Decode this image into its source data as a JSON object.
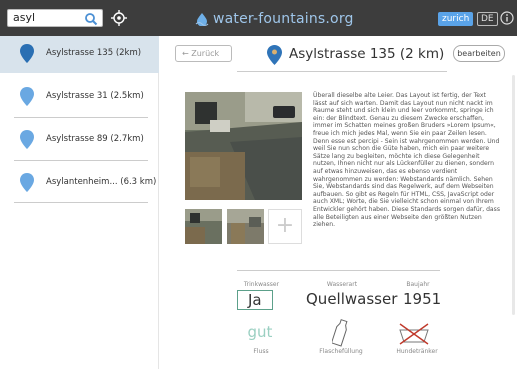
{
  "topbar": {
    "search_value": "asyl",
    "brand": "water-fountains.org",
    "city_button": "zurich",
    "lang_button": "DE",
    "icons": [
      "search-icon",
      "crosshair-icon",
      "droplet-logo-icon",
      "info-icon"
    ]
  },
  "sidebar": {
    "items": [
      {
        "label": "Asylstrasse 135  (2km)"
      },
      {
        "label": "Asylstrasse 31 (2.5km)"
      },
      {
        "label": "Asylstrasse 89 (2.7km)"
      },
      {
        "label": "Asylantenheim... (6.3 km)"
      }
    ]
  },
  "detail": {
    "back_label": "Zurück",
    "edit_label": "bearbeiten",
    "title": "Asylstrasse 135 (2 km)",
    "description": "Überall dieselbe alte Leier. Das Layout ist fertig, der Text lässt auf sich warten. Damit das Layout nun nicht nackt im Raume steht und sich klein und leer vorkommt, springe ich ein: der Blindtext. Genau zu diesem Zwecke erschaffen, immer im Schatten meines großen Bruders »Lorem Ipsum«, freue ich mich jedes Mal, wenn Sie ein paar Zeilen lesen. Denn esse est percipi - Sein ist wahrgenommen werden. Und weil Sie nun schon die Güte haben, mich ein paar weitere Sätze lang zu begleiten, möchte ich diese Gelegenheit nutzen, Ihnen nicht nur als Lückenfüller zu dienen, sondern auf etwas hinzuweisen, das es ebenso verdient wahrgenommen zu werden: Webstandards nämlich. Sehen Sie, Webstandards sind das Regelwerk, auf dem Webseiten aufbauen. So gibt es Regeln für HTML, CSS, JavaScript oder auch XML; Worte, die Sie vielleicht schon einmal von Ihrem Entwickler gehört haben. Diese Standards sorgen dafür, dass alle Beteiligten aus einer Webseite den größten Nutzen ziehen.",
    "stats": [
      {
        "label": "Trinkwasser",
        "value": "Ja"
      },
      {
        "label": "Wasserart",
        "value": "Quellwasser"
      },
      {
        "label": "Baujahr",
        "value": "1951"
      }
    ],
    "features": [
      {
        "label": "Fluss",
        "value": "gut"
      },
      {
        "label": "Flaschefüllung"
      },
      {
        "label": "Hundetränker"
      }
    ]
  },
  "colors": {
    "topbar": "#3d3d3d",
    "accent": "#5aa3e8",
    "pin": "#4a8fd4",
    "active_row": "#d8e3ec",
    "teal": "#5ca08a"
  }
}
